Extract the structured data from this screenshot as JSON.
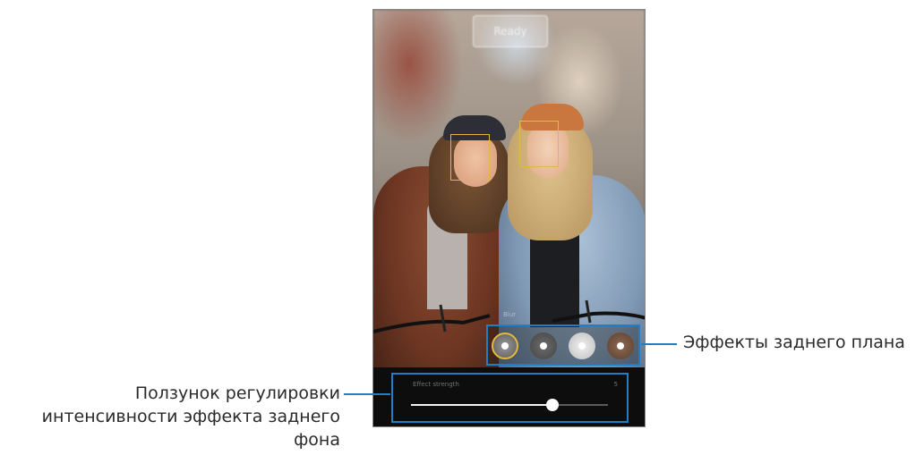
{
  "screen": {
    "status_button_label": "Ready",
    "bokeh_label": "Blur"
  },
  "background_effects": {
    "callout_label": "Эффекты заднего плана",
    "items": [
      {
        "name": "blur",
        "selected": true
      },
      {
        "name": "big-circle",
        "selected": false
      },
      {
        "name": "color-point",
        "selected": false
      },
      {
        "name": "zoom",
        "selected": false
      }
    ]
  },
  "effect_slider": {
    "label": "Effect strength",
    "value_text": "5",
    "fraction": 0.72,
    "callout_lines": [
      "Ползунок регулировки",
      "интенсивности эффекта заднего",
      "фона"
    ]
  },
  "colors": {
    "accent": "#1f7ec5",
    "face_box": "#e2b93c"
  }
}
